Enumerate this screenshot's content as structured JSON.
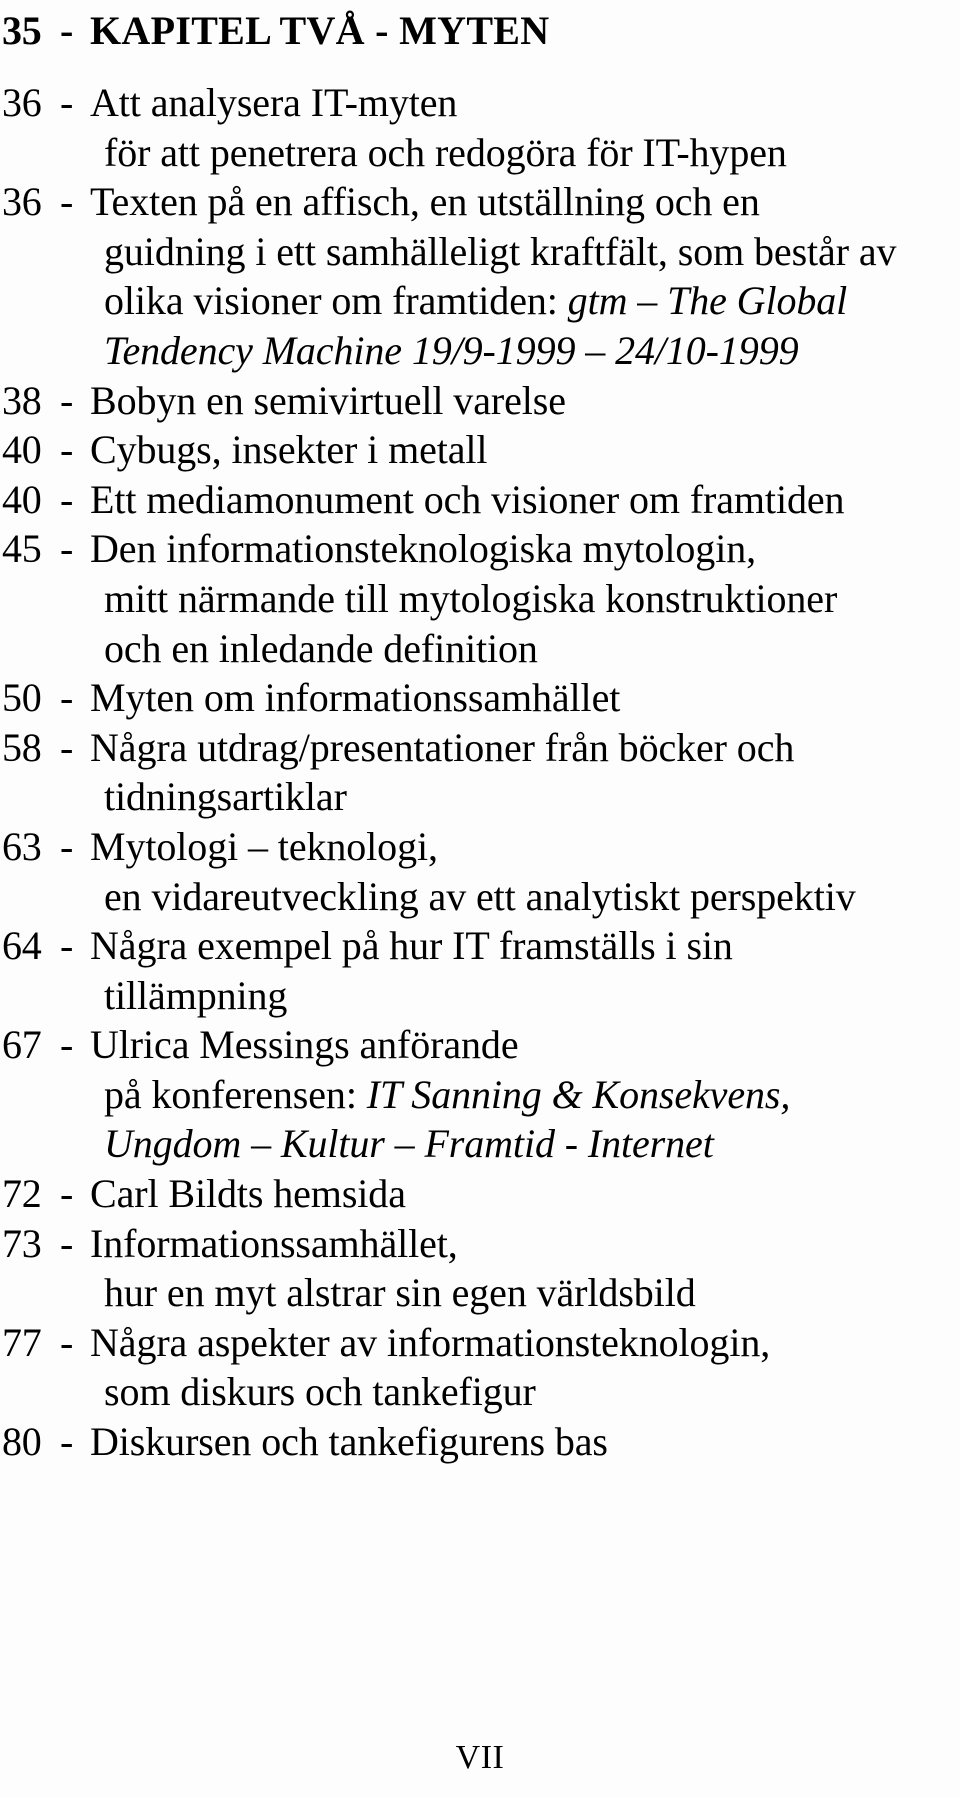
{
  "document": {
    "type": "table-of-contents",
    "language": "sv",
    "page_label": "VII",
    "background_color": "#fdfdfd",
    "text_color": "#000000"
  },
  "entries": [
    {
      "number": "35",
      "separator": "-",
      "style": "bold",
      "lines": [
        {
          "segments": [
            {
              "text": "KAPITEL TVÅ - MYTEN",
              "style": "bold"
            }
          ]
        }
      ]
    },
    {
      "number": "36",
      "separator": "-",
      "style": "regular",
      "lines": [
        {
          "segments": [
            {
              "text": "Att analysera IT-myten",
              "style": "regular"
            }
          ]
        },
        {
          "segments": [
            {
              "text": "för att penetrera och redogöra för IT-hypen",
              "style": "regular"
            }
          ]
        }
      ]
    },
    {
      "number": "36",
      "separator": "-",
      "style": "regular",
      "lines": [
        {
          "segments": [
            {
              "text": "Texten på en affisch, en utställning och en",
              "style": "regular"
            }
          ]
        },
        {
          "segments": [
            {
              "text": "guidning i ett samhälleligt kraftfält, som består av",
              "style": "regular"
            }
          ]
        },
        {
          "segments": [
            {
              "text": "olika visioner om framtiden: ",
              "style": "regular"
            },
            {
              "text": "gtm – The Global",
              "style": "italic"
            }
          ]
        },
        {
          "segments": [
            {
              "text": "Tendency Machine 19/9-1999 – 24/10-1999",
              "style": "italic"
            }
          ]
        }
      ]
    },
    {
      "number": "38",
      "separator": "-",
      "style": "regular",
      "lines": [
        {
          "segments": [
            {
              "text": "Bobyn en semivirtuell varelse",
              "style": "regular"
            }
          ]
        }
      ]
    },
    {
      "number": "40",
      "separator": "-",
      "style": "regular",
      "lines": [
        {
          "segments": [
            {
              "text": "Cybugs, insekter i metall",
              "style": "regular"
            }
          ]
        }
      ]
    },
    {
      "number": "40",
      "separator": "-",
      "style": "regular",
      "lines": [
        {
          "segments": [
            {
              "text": "Ett mediamonument och visioner om framtiden",
              "style": "regular"
            }
          ]
        }
      ]
    },
    {
      "number": "45",
      "separator": "-",
      "style": "regular",
      "lines": [
        {
          "segments": [
            {
              "text": "Den informationsteknologiska mytologin,",
              "style": "regular"
            }
          ]
        },
        {
          "segments": [
            {
              "text": "mitt närmande till mytologiska konstruktioner",
              "style": "regular"
            }
          ]
        },
        {
          "segments": [
            {
              "text": "och en inledande definition",
              "style": "regular"
            }
          ]
        }
      ]
    },
    {
      "number": "50",
      "separator": "-",
      "style": "regular",
      "lines": [
        {
          "segments": [
            {
              "text": "Myten om informationssamhället",
              "style": "regular"
            }
          ]
        }
      ]
    },
    {
      "number": "58",
      "separator": "-",
      "style": "regular",
      "lines": [
        {
          "segments": [
            {
              "text": "Några utdrag/presentationer från böcker och",
              "style": "regular"
            }
          ]
        },
        {
          "segments": [
            {
              "text": "tidningsartiklar",
              "style": "regular"
            }
          ]
        }
      ]
    },
    {
      "number": "63",
      "separator": "-",
      "style": "regular",
      "lines": [
        {
          "segments": [
            {
              "text": "Mytologi – teknologi,",
              "style": "regular"
            }
          ]
        },
        {
          "segments": [
            {
              "text": "en vidareutveckling av ett analytiskt perspektiv",
              "style": "regular"
            }
          ]
        }
      ]
    },
    {
      "number": "64",
      "separator": "-",
      "style": "regular",
      "lines": [
        {
          "segments": [
            {
              "text": "Några exempel på hur IT framställs i sin",
              "style": "regular"
            }
          ]
        },
        {
          "segments": [
            {
              "text": "tillämpning",
              "style": "regular"
            }
          ]
        }
      ]
    },
    {
      "number": "67",
      "separator": "-",
      "style": "regular",
      "lines": [
        {
          "segments": [
            {
              "text": "Ulrica Messings anförande",
              "style": "regular"
            }
          ]
        },
        {
          "segments": [
            {
              "text": "på konferensen: ",
              "style": "regular"
            },
            {
              "text": "IT Sanning & Konsekvens,",
              "style": "italic"
            }
          ]
        },
        {
          "segments": [
            {
              "text": "Ungdom – Kultur – Framtid - Internet",
              "style": "italic"
            }
          ]
        }
      ]
    },
    {
      "number": "72",
      "separator": "-",
      "style": "regular",
      "lines": [
        {
          "segments": [
            {
              "text": "Carl Bildts hemsida",
              "style": "regular"
            }
          ]
        }
      ]
    },
    {
      "number": "73",
      "separator": "-",
      "style": "regular",
      "lines": [
        {
          "segments": [
            {
              "text": "Informationssamhället,",
              "style": "regular"
            }
          ]
        },
        {
          "segments": [
            {
              "text": "hur en myt alstrar sin egen världsbild",
              "style": "regular"
            }
          ]
        }
      ]
    },
    {
      "number": "77",
      "separator": "-",
      "style": "regular",
      "lines": [
        {
          "segments": [
            {
              "text": "Några aspekter av informationsteknologin,",
              "style": "regular"
            }
          ]
        },
        {
          "segments": [
            {
              "text": "som diskurs och tankefigur",
              "style": "regular"
            }
          ]
        }
      ]
    },
    {
      "number": "80",
      "separator": "-",
      "style": "regular",
      "lines": [
        {
          "segments": [
            {
              "text": "Diskursen och tankefigurens bas",
              "style": "regular"
            }
          ]
        }
      ]
    }
  ],
  "folio": {
    "label": "VII"
  }
}
